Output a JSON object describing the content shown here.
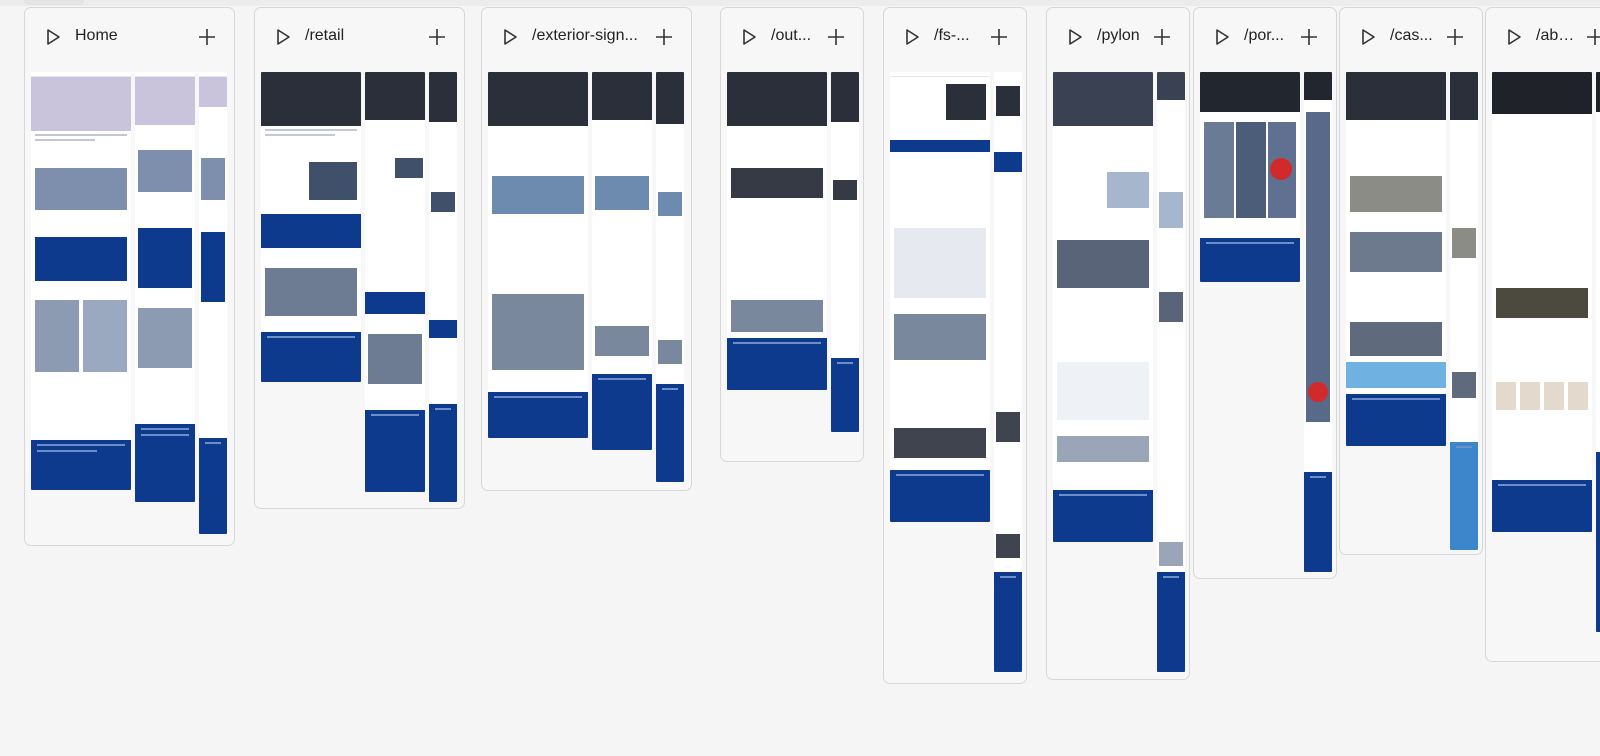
{
  "canvas": {
    "columns": [
      {
        "id": "home",
        "title": "Home"
      },
      {
        "id": "retail",
        "title": "/retail"
      },
      {
        "id": "exterior",
        "title": "/exterior-sign..."
      },
      {
        "id": "out",
        "title": "/out..."
      },
      {
        "id": "fs",
        "title": "/fs-..."
      },
      {
        "id": "pylon",
        "title": "/pylon"
      },
      {
        "id": "por",
        "title": "/por..."
      },
      {
        "id": "cas",
        "title": "/cas..."
      },
      {
        "id": "abo",
        "title": "/abo..."
      }
    ]
  },
  "colors": {
    "column_bg": "#f7f7f8",
    "border": "#d7d7da",
    "brand_blue": "#0d3a8c",
    "hero_dark": "#2b2f3a",
    "hero_lavender": "#c9c3dc"
  },
  "icons": {
    "play": "play-icon",
    "add": "plus-icon"
  }
}
